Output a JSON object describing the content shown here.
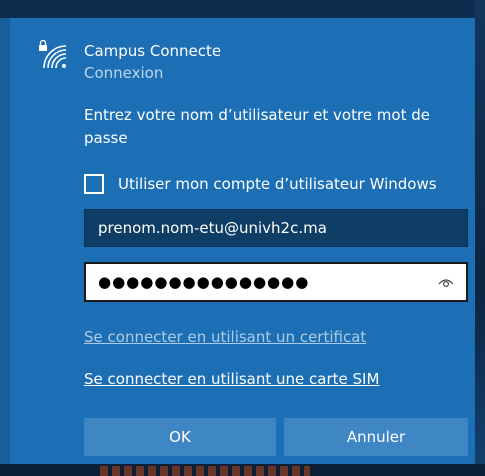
{
  "network": {
    "name": "Campus Connecte",
    "status": "Connexion",
    "icon": "secured-wifi-icon"
  },
  "prompt": "Entrez votre nom d’utilisateur et votre mot de passe",
  "windows_account_checkbox": {
    "label": "Utiliser mon compte d’utilisateur Windows",
    "checked": false
  },
  "username": {
    "value": "prenom.nom-etu@univh2c.ma"
  },
  "password": {
    "masked_value": "●●●●●●●●●●●●●●●",
    "reveal_icon": "eye-icon"
  },
  "links": {
    "certificate": "Se connecter en utilisant un certificat",
    "sim": "Se connecter en utilisant une carte SIM"
  },
  "buttons": {
    "ok": "OK",
    "cancel": "Annuler"
  },
  "colors": {
    "panel": "#1c6fb4",
    "button": "#3f86c4",
    "username_field": "#0e3d66"
  }
}
